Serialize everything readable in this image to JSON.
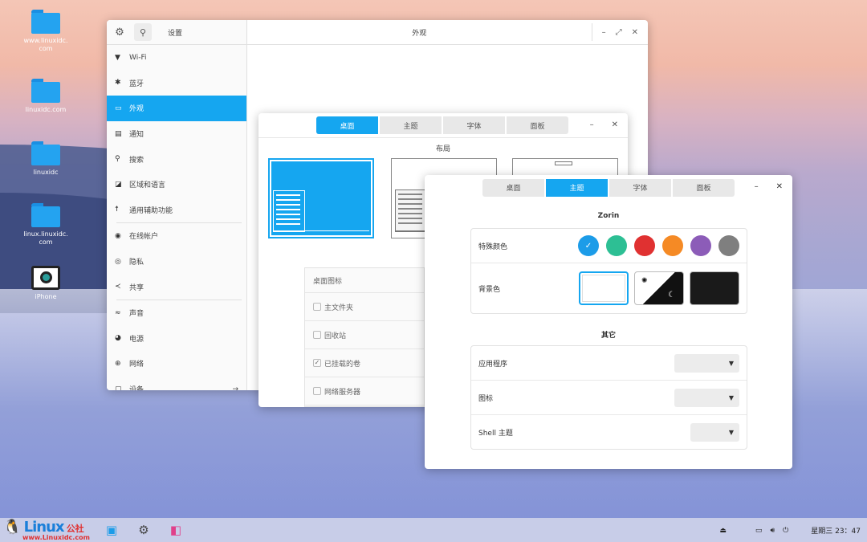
{
  "desktop": {
    "icons": [
      {
        "label": "www.linuxidc.\ncom",
        "kind": "folder"
      },
      {
        "label": "linuxidc.com",
        "kind": "folder"
      },
      {
        "label": "linuxidc",
        "kind": "folder"
      },
      {
        "label": "linux.linuxidc.\ncom",
        "kind": "folder"
      },
      {
        "label": "iPhone",
        "kind": "camera"
      }
    ]
  },
  "settings": {
    "sidebar_title": "设置",
    "main_title": "外观",
    "nav": [
      {
        "icon": "wifi-icon",
        "glyph": "▼",
        "label": "Wi-Fi"
      },
      {
        "icon": "bluetooth-icon",
        "glyph": "✱",
        "label": "蓝牙"
      },
      {
        "icon": "display-icon",
        "glyph": "▭",
        "label": "外观",
        "active": true
      },
      {
        "icon": "notification-icon",
        "glyph": "▤",
        "label": "通知"
      },
      {
        "icon": "search-icon",
        "glyph": "⚲",
        "label": "搜索"
      },
      {
        "icon": "region-icon",
        "glyph": "◪",
        "label": "区域和语言"
      },
      {
        "icon": "accessibility-icon",
        "glyph": "☨",
        "label": "通用辅助功能"
      },
      {
        "icon": "online-accounts-icon",
        "glyph": "◉",
        "label": "在线帐户"
      },
      {
        "icon": "privacy-icon",
        "glyph": "◎",
        "label": "隐私"
      },
      {
        "icon": "share-icon",
        "glyph": "≺",
        "label": "共享"
      },
      {
        "icon": "sound-icon",
        "glyph": "≈",
        "label": "声音"
      },
      {
        "icon": "power-icon",
        "glyph": "◕",
        "label": "电源"
      },
      {
        "icon": "network-icon",
        "glyph": "⊕",
        "label": "网络"
      },
      {
        "icon": "devices-icon",
        "glyph": "▢",
        "label": "设备"
      }
    ]
  },
  "tweak": {
    "tabs": [
      "桌面",
      "主题",
      "字体",
      "面板"
    ],
    "active_tab": 0,
    "layout_label": "布局",
    "desktop_icons": {
      "heading": "桌面图标",
      "items": [
        {
          "label": "主文件夹",
          "checked": false
        },
        {
          "label": "回收站",
          "checked": false
        },
        {
          "label": "已挂载的卷",
          "checked": true
        },
        {
          "label": "网络服务器",
          "checked": false
        }
      ]
    }
  },
  "theme": {
    "tabs": [
      "桌面",
      "主题",
      "字体",
      "面板"
    ],
    "active_tab": 1,
    "section1_title": "Zorin",
    "accent_label": "特殊颜色",
    "accent_colors": [
      "#1c9ce8",
      "#2dbf94",
      "#e03131",
      "#f58a25",
      "#8c5cb8",
      "#7f7f7f"
    ],
    "accent_selected": 0,
    "background_label": "背景色",
    "section2_title": "其它",
    "other_rows": [
      {
        "label": "应用程序"
      },
      {
        "label": "图标"
      },
      {
        "label": "Shell 主题"
      }
    ]
  },
  "taskbar": {
    "brand_big": "Linux",
    "brand_cn": "公社",
    "brand_url": "www.Linuxidc.com",
    "clock": "星期三 23：47"
  }
}
